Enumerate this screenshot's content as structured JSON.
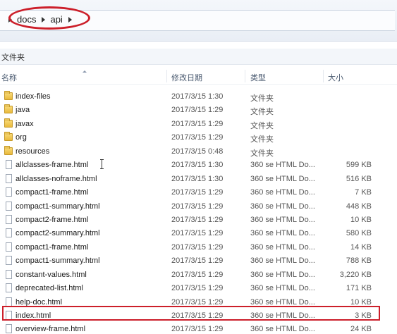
{
  "address_bar": {
    "crumbs": [
      "docs",
      "api"
    ]
  },
  "toolbar": {
    "label": "文件夹"
  },
  "columns": {
    "name": "名称",
    "date": "修改日期",
    "type": "类型",
    "size": "大小"
  },
  "files": [
    {
      "name": "index-files",
      "date": "2017/3/15 1:30",
      "type": "文件夹",
      "size": "",
      "kind": "folder"
    },
    {
      "name": "java",
      "date": "2017/3/15 1:29",
      "type": "文件夹",
      "size": "",
      "kind": "folder"
    },
    {
      "name": "javax",
      "date": "2017/3/15 1:29",
      "type": "文件夹",
      "size": "",
      "kind": "folder"
    },
    {
      "name": "org",
      "date": "2017/3/15 1:29",
      "type": "文件夹",
      "size": "",
      "kind": "folder"
    },
    {
      "name": "resources",
      "date": "2017/3/15 0:48",
      "type": "文件夹",
      "size": "",
      "kind": "folder"
    },
    {
      "name": "allclasses-frame.html",
      "date": "2017/3/15 1:30",
      "type": "360 se HTML Do...",
      "size": "599 KB",
      "kind": "file"
    },
    {
      "name": "allclasses-noframe.html",
      "date": "2017/3/15 1:30",
      "type": "360 se HTML Do...",
      "size": "516 KB",
      "kind": "file"
    },
    {
      "name": "compact1-frame.html",
      "date": "2017/3/15 1:29",
      "type": "360 se HTML Do...",
      "size": "7 KB",
      "kind": "file"
    },
    {
      "name": "compact1-summary.html",
      "date": "2017/3/15 1:29",
      "type": "360 se HTML Do...",
      "size": "448 KB",
      "kind": "file"
    },
    {
      "name": "compact2-frame.html",
      "date": "2017/3/15 1:29",
      "type": "360 se HTML Do...",
      "size": "10 KB",
      "kind": "file"
    },
    {
      "name": "compact2-summary.html",
      "date": "2017/3/15 1:29",
      "type": "360 se HTML Do...",
      "size": "580 KB",
      "kind": "file"
    },
    {
      "name": "compact1-frame.html",
      "date": "2017/3/15 1:29",
      "type": "360 se HTML Do...",
      "size": "14 KB",
      "kind": "file"
    },
    {
      "name": "compact1-summary.html",
      "date": "2017/3/15 1:29",
      "type": "360 se HTML Do...",
      "size": "788 KB",
      "kind": "file"
    },
    {
      "name": "constant-values.html",
      "date": "2017/3/15 1:29",
      "type": "360 se HTML Do...",
      "size": "3,220 KB",
      "kind": "file"
    },
    {
      "name": "deprecated-list.html",
      "date": "2017/3/15 1:29",
      "type": "360 se HTML Do...",
      "size": "171 KB",
      "kind": "file"
    },
    {
      "name": "help-doc.html",
      "date": "2017/3/15 1:29",
      "type": "360 se HTML Do...",
      "size": "10 KB",
      "kind": "file"
    },
    {
      "name": "index.html",
      "date": "2017/3/15 1:29",
      "type": "360 se HTML Do...",
      "size": "3 KB",
      "kind": "file"
    },
    {
      "name": "overview-frame.html",
      "date": "2017/3/15 1:29",
      "type": "360 se HTML Do...",
      "size": "24 KB",
      "kind": "file"
    }
  ]
}
